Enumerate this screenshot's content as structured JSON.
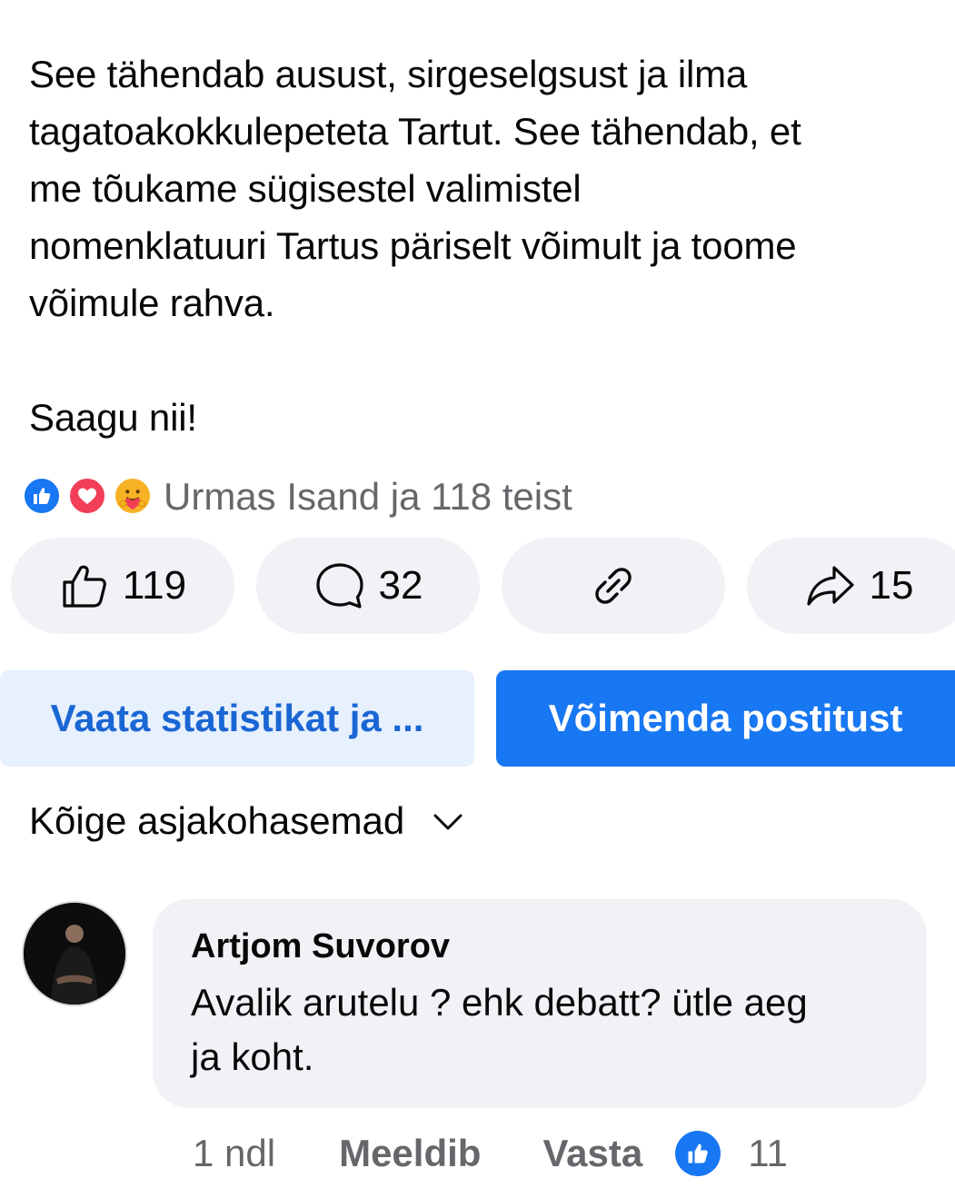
{
  "post": {
    "paragraph_lines": [
      "See tähendab ausust, sirgeselgsust ja ilma",
      "tagatoakokkulepeteta Tartut. See tähendab, et",
      "me tõukame sügisestel valimistel",
      "nomenklatuuri Tartus päriselt võimult ja toome",
      "võimule rahva."
    ],
    "closing": "Saagu nii!"
  },
  "reactions": {
    "icons": [
      "like-icon",
      "love-icon",
      "care-icon"
    ],
    "summary": "Urmas Isand ja 118 teist"
  },
  "actions": {
    "like_count": "119",
    "comment_count": "32",
    "share_count": "15"
  },
  "buttons": {
    "stats_label": "Vaata statistikat ja ...",
    "boost_label": "Võimenda postitust"
  },
  "sort": {
    "label": "Kõige asjakohasemad"
  },
  "comment": {
    "author": "Artjom Suvorov",
    "text_lines": [
      "Avalik arutelu ? ehk debatt? ütle aeg",
      "ja koht."
    ],
    "time": "1 ndl",
    "like_label": "Meeldib",
    "reply_label": "Vasta",
    "reaction_count": "11"
  },
  "colors": {
    "accent": "#1877f2",
    "pill_bg": "#f0f2f5",
    "secondary_text": "#65676b"
  }
}
